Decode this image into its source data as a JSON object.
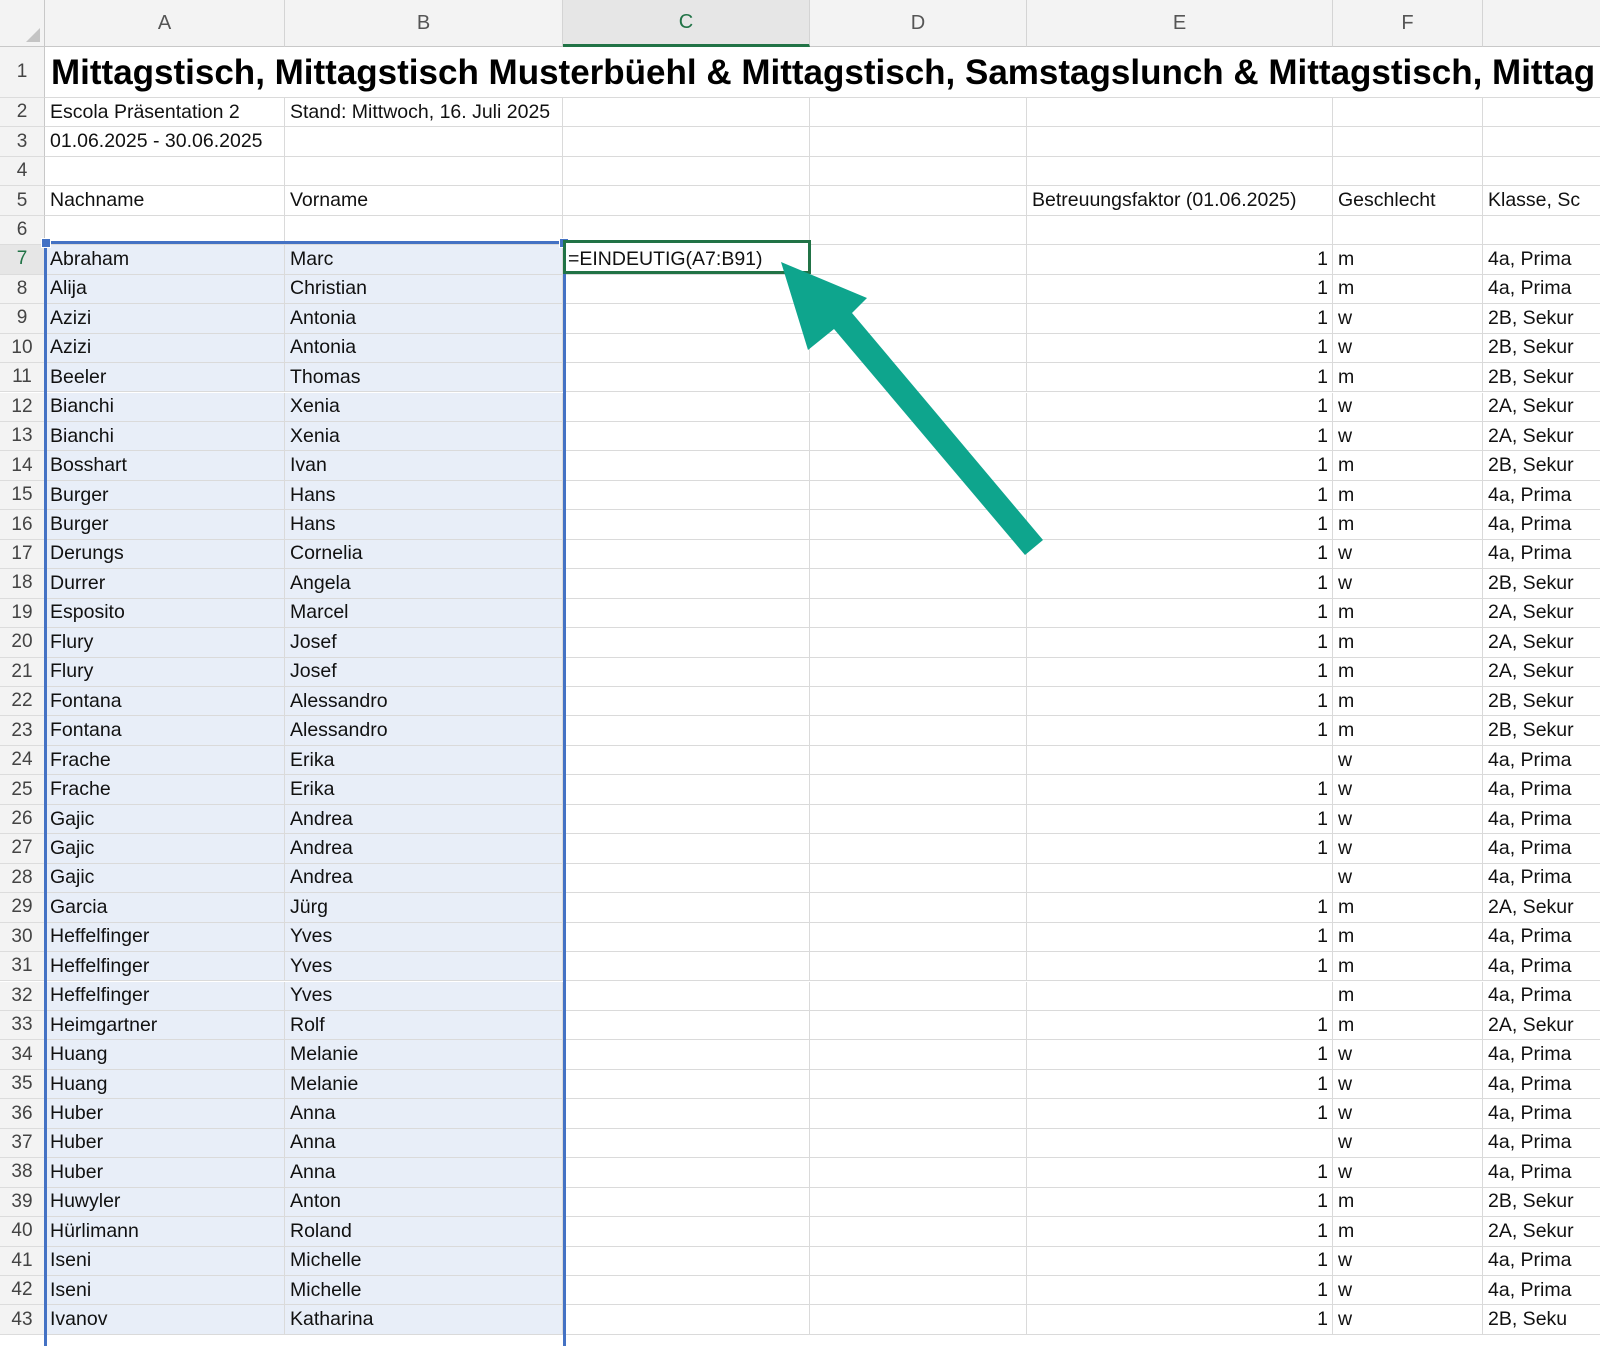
{
  "spreadsheet": {
    "columns": [
      "A",
      "B",
      "C",
      "D",
      "E",
      "F",
      ""
    ],
    "active_column": "C",
    "title": "Mittagstisch, Mittagstisch Musterbüehl & Mittagstisch, Samstagslunch & Mittagstisch, Mittag",
    "meta": {
      "company": "Escola Präsentation 2",
      "stand": "Stand: Mittwoch, 16. Juli 2025",
      "period": "01.06.2025 - 30.06.2025"
    },
    "headers": {
      "nachname": "Nachname",
      "vorname": "Vorname",
      "betreuungsfaktor": "Betreuungsfaktor (01.06.2025)",
      "geschlecht": "Geschlecht",
      "klasse": "Klasse, Sc"
    },
    "active_cell": {
      "ref": "C7",
      "formula": "=EINDEUTIG(A7:B91)"
    },
    "selection": "A7:B91",
    "annotation": {
      "arrow_color": "#0ea58d"
    },
    "rows": [
      {
        "n": "7",
        "last": "Abraham",
        "first": "Marc",
        "faktor": "1",
        "g": "m",
        "klasse": "4a, Prima"
      },
      {
        "n": "8",
        "last": "Alija",
        "first": "Christian",
        "faktor": "1",
        "g": "m",
        "klasse": "4a, Prima"
      },
      {
        "n": "9",
        "last": "Azizi",
        "first": "Antonia",
        "faktor": "1",
        "g": "w",
        "klasse": "2B, Sekur"
      },
      {
        "n": "10",
        "last": "Azizi",
        "first": "Antonia",
        "faktor": "1",
        "g": "w",
        "klasse": "2B, Sekur"
      },
      {
        "n": "11",
        "last": "Beeler",
        "first": "Thomas",
        "faktor": "1",
        "g": "m",
        "klasse": "2B, Sekur"
      },
      {
        "n": "12",
        "last": "Bianchi",
        "first": "Xenia",
        "faktor": "1",
        "g": "w",
        "klasse": "2A, Sekur"
      },
      {
        "n": "13",
        "last": "Bianchi",
        "first": "Xenia",
        "faktor": "1",
        "g": "w",
        "klasse": "2A, Sekur"
      },
      {
        "n": "14",
        "last": "Bosshart",
        "first": "Ivan",
        "faktor": "1",
        "g": "m",
        "klasse": "2B, Sekur"
      },
      {
        "n": "15",
        "last": "Burger",
        "first": "Hans",
        "faktor": "1",
        "g": "m",
        "klasse": "4a, Prima"
      },
      {
        "n": "16",
        "last": "Burger",
        "first": "Hans",
        "faktor": "1",
        "g": "m",
        "klasse": "4a, Prima"
      },
      {
        "n": "17",
        "last": "Derungs",
        "first": "Cornelia",
        "faktor": "1",
        "g": "w",
        "klasse": "4a, Prima"
      },
      {
        "n": "18",
        "last": "Durrer",
        "first": "Angela",
        "faktor": "1",
        "g": "w",
        "klasse": "2B, Sekur"
      },
      {
        "n": "19",
        "last": "Esposito",
        "first": "Marcel",
        "faktor": "1",
        "g": "m",
        "klasse": "2A, Sekur"
      },
      {
        "n": "20",
        "last": "Flury",
        "first": "Josef",
        "faktor": "1",
        "g": "m",
        "klasse": "2A, Sekur"
      },
      {
        "n": "21",
        "last": "Flury",
        "first": "Josef",
        "faktor": "1",
        "g": "m",
        "klasse": "2A, Sekur"
      },
      {
        "n": "22",
        "last": "Fontana",
        "first": "Alessandro",
        "faktor": "1",
        "g": "m",
        "klasse": "2B, Sekur"
      },
      {
        "n": "23",
        "last": "Fontana",
        "first": "Alessandro",
        "faktor": "1",
        "g": "m",
        "klasse": "2B, Sekur"
      },
      {
        "n": "24",
        "last": "Frache",
        "first": "Erika",
        "faktor": "",
        "g": "w",
        "klasse": "4a, Prima"
      },
      {
        "n": "25",
        "last": "Frache",
        "first": "Erika",
        "faktor": "1",
        "g": "w",
        "klasse": "4a, Prima"
      },
      {
        "n": "26",
        "last": "Gajic",
        "first": "Andrea",
        "faktor": "1",
        "g": "w",
        "klasse": "4a, Prima"
      },
      {
        "n": "27",
        "last": "Gajic",
        "first": "Andrea",
        "faktor": "1",
        "g": "w",
        "klasse": "4a, Prima"
      },
      {
        "n": "28",
        "last": "Gajic",
        "first": "Andrea",
        "faktor": "",
        "g": "w",
        "klasse": "4a, Prima"
      },
      {
        "n": "29",
        "last": "Garcia",
        "first": "Jürg",
        "faktor": "1",
        "g": "m",
        "klasse": "2A, Sekur"
      },
      {
        "n": "30",
        "last": "Heffelfinger",
        "first": "Yves",
        "faktor": "1",
        "g": "m",
        "klasse": "4a, Prima"
      },
      {
        "n": "31",
        "last": "Heffelfinger",
        "first": "Yves",
        "faktor": "1",
        "g": "m",
        "klasse": "4a, Prima"
      },
      {
        "n": "32",
        "last": "Heffelfinger",
        "first": "Yves",
        "faktor": "",
        "g": "m",
        "klasse": "4a, Prima"
      },
      {
        "n": "33",
        "last": "Heimgartner",
        "first": "Rolf",
        "faktor": "1",
        "g": "m",
        "klasse": "2A, Sekur"
      },
      {
        "n": "34",
        "last": "Huang",
        "first": "Melanie",
        "faktor": "1",
        "g": "w",
        "klasse": "4a, Prima"
      },
      {
        "n": "35",
        "last": "Huang",
        "first": "Melanie",
        "faktor": "1",
        "g": "w",
        "klasse": "4a, Prima"
      },
      {
        "n": "36",
        "last": "Huber",
        "first": "Anna",
        "faktor": "1",
        "g": "w",
        "klasse": "4a, Prima"
      },
      {
        "n": "37",
        "last": "Huber",
        "first": "Anna",
        "faktor": "",
        "g": "w",
        "klasse": "4a, Prima"
      },
      {
        "n": "38",
        "last": "Huber",
        "first": "Anna",
        "faktor": "1",
        "g": "w",
        "klasse": "4a, Prima"
      },
      {
        "n": "39",
        "last": "Huwyler",
        "first": "Anton",
        "faktor": "1",
        "g": "m",
        "klasse": "2B, Sekur"
      },
      {
        "n": "40",
        "last": "Hürlimann",
        "first": "Roland",
        "faktor": "1",
        "g": "m",
        "klasse": "2A, Sekur"
      },
      {
        "n": "41",
        "last": "Iseni",
        "first": "Michelle",
        "faktor": "1",
        "g": "w",
        "klasse": "4a, Prima"
      },
      {
        "n": "42",
        "last": "Iseni",
        "first": "Michelle",
        "faktor": "1",
        "g": "w",
        "klasse": "4a, Prima"
      },
      {
        "n": "43",
        "last": "Ivanov",
        "first": "Katharina",
        "faktor": "1",
        "g": "w",
        "klasse": "2B, Seku"
      }
    ]
  }
}
